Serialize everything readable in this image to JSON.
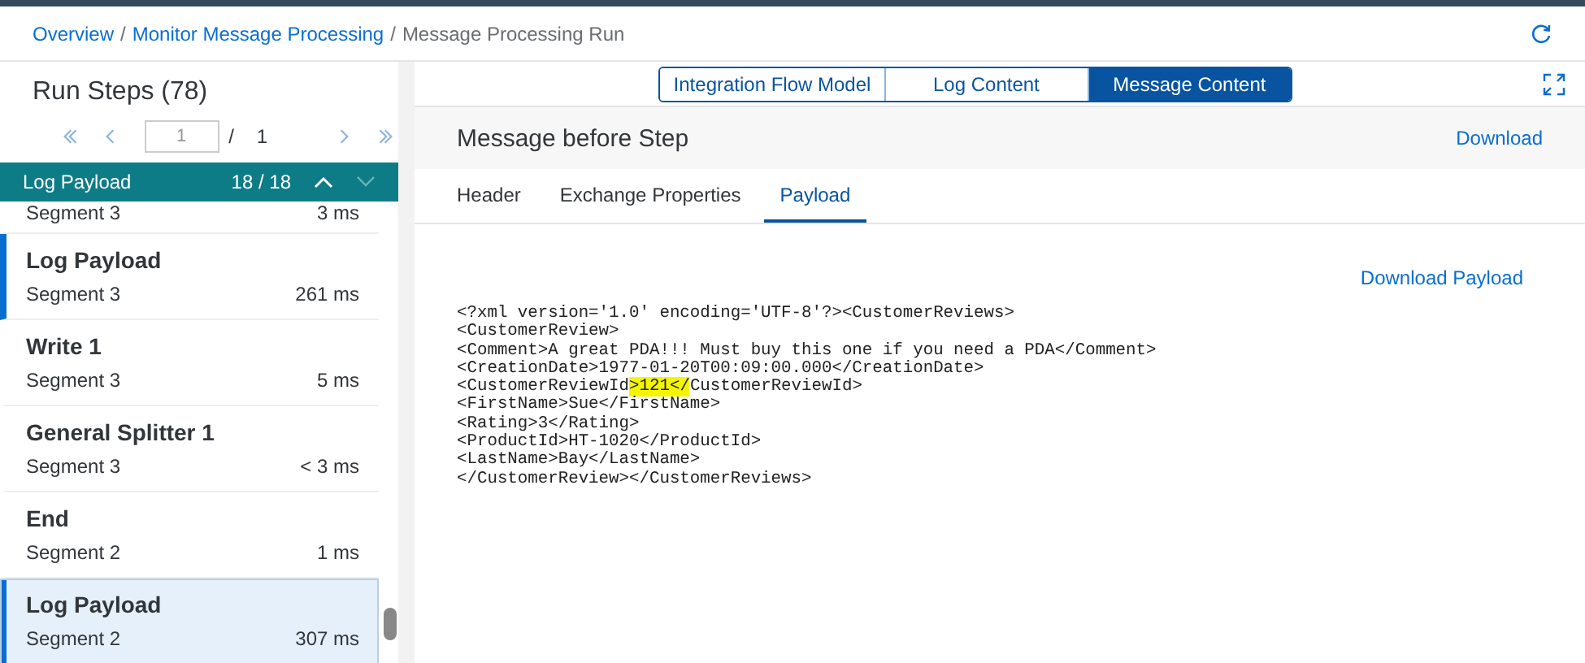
{
  "breadcrumb": [
    {
      "label": "Overview",
      "link": true
    },
    {
      "separator": "/",
      "label": "Monitor Message Processing",
      "link": true
    },
    {
      "separator": "/",
      "label": "Message Processing Run",
      "link": false
    }
  ],
  "run_steps": {
    "title": "Run Steps (78)",
    "pager": {
      "page": "1",
      "separator": "/",
      "total": "1"
    },
    "search_bar": {
      "label": "Log Payload",
      "count": "18 / 18"
    },
    "items": [
      {
        "segment": "Segment 3",
        "duration": "3 ms",
        "marked": false,
        "selected": false
      },
      {
        "title": "Log Payload",
        "segment": "Segment 3",
        "duration": "261 ms",
        "marked": true,
        "selected": false
      },
      {
        "title": "Write 1",
        "segment": "Segment 3",
        "duration": "5 ms",
        "marked": false,
        "selected": false
      },
      {
        "title": "General Splitter 1",
        "segment": "Segment 3",
        "duration": "< 3 ms",
        "marked": false,
        "selected": false
      },
      {
        "title": "End",
        "segment": "Segment 2",
        "duration": "1 ms",
        "marked": false,
        "selected": false
      },
      {
        "title": "Log Payload",
        "segment": "Segment 2",
        "duration": "307 ms",
        "marked": true,
        "selected": true
      }
    ]
  },
  "views": [
    {
      "label": "Integration Flow Model",
      "selected": false
    },
    {
      "label": "Log Content",
      "selected": false
    },
    {
      "label": "Message Content",
      "selected": true
    }
  ],
  "message": {
    "title": "Message before Step",
    "download": "Download",
    "tabs": [
      {
        "label": "Header",
        "selected": false
      },
      {
        "label": "Exchange Properties",
        "selected": false
      },
      {
        "label": "Payload",
        "selected": true
      }
    ],
    "download_payload": "Download Payload",
    "lines": [
      [
        {
          "text": "<?xml version='1.0' encoding='UTF-8'?><CustomerReviews>",
          "highlighted": false
        }
      ],
      [
        {
          "text": "<CustomerReview>",
          "highlighted": false
        }
      ],
      [
        {
          "text": "<Comment>A great PDA!!! Must buy this one if you need a PDA</Comment>",
          "highlighted": false
        }
      ],
      [
        {
          "text": "<CreationDate>1977-01-20T00:09:00.000</CreationDate>",
          "highlighted": false
        }
      ],
      [
        {
          "text": "<CustomerReviewId",
          "highlighted": false
        },
        {
          "text": ">121</",
          "highlighted": true
        },
        {
          "text": "CustomerReviewId>",
          "highlighted": false
        }
      ],
      [
        {
          "text": "<FirstName>Sue</FirstName>",
          "highlighted": false
        }
      ],
      [
        {
          "text": "<Rating>3</Rating>",
          "highlighted": false
        }
      ],
      [
        {
          "text": "<ProductId>HT-1020</ProductId>",
          "highlighted": false
        }
      ],
      [
        {
          "text": "<LastName>Bay</LastName>",
          "highlighted": false
        }
      ],
      [
        {
          "text": "</CustomerReview></CustomerReviews>",
          "highlighted": false
        }
      ]
    ]
  }
}
